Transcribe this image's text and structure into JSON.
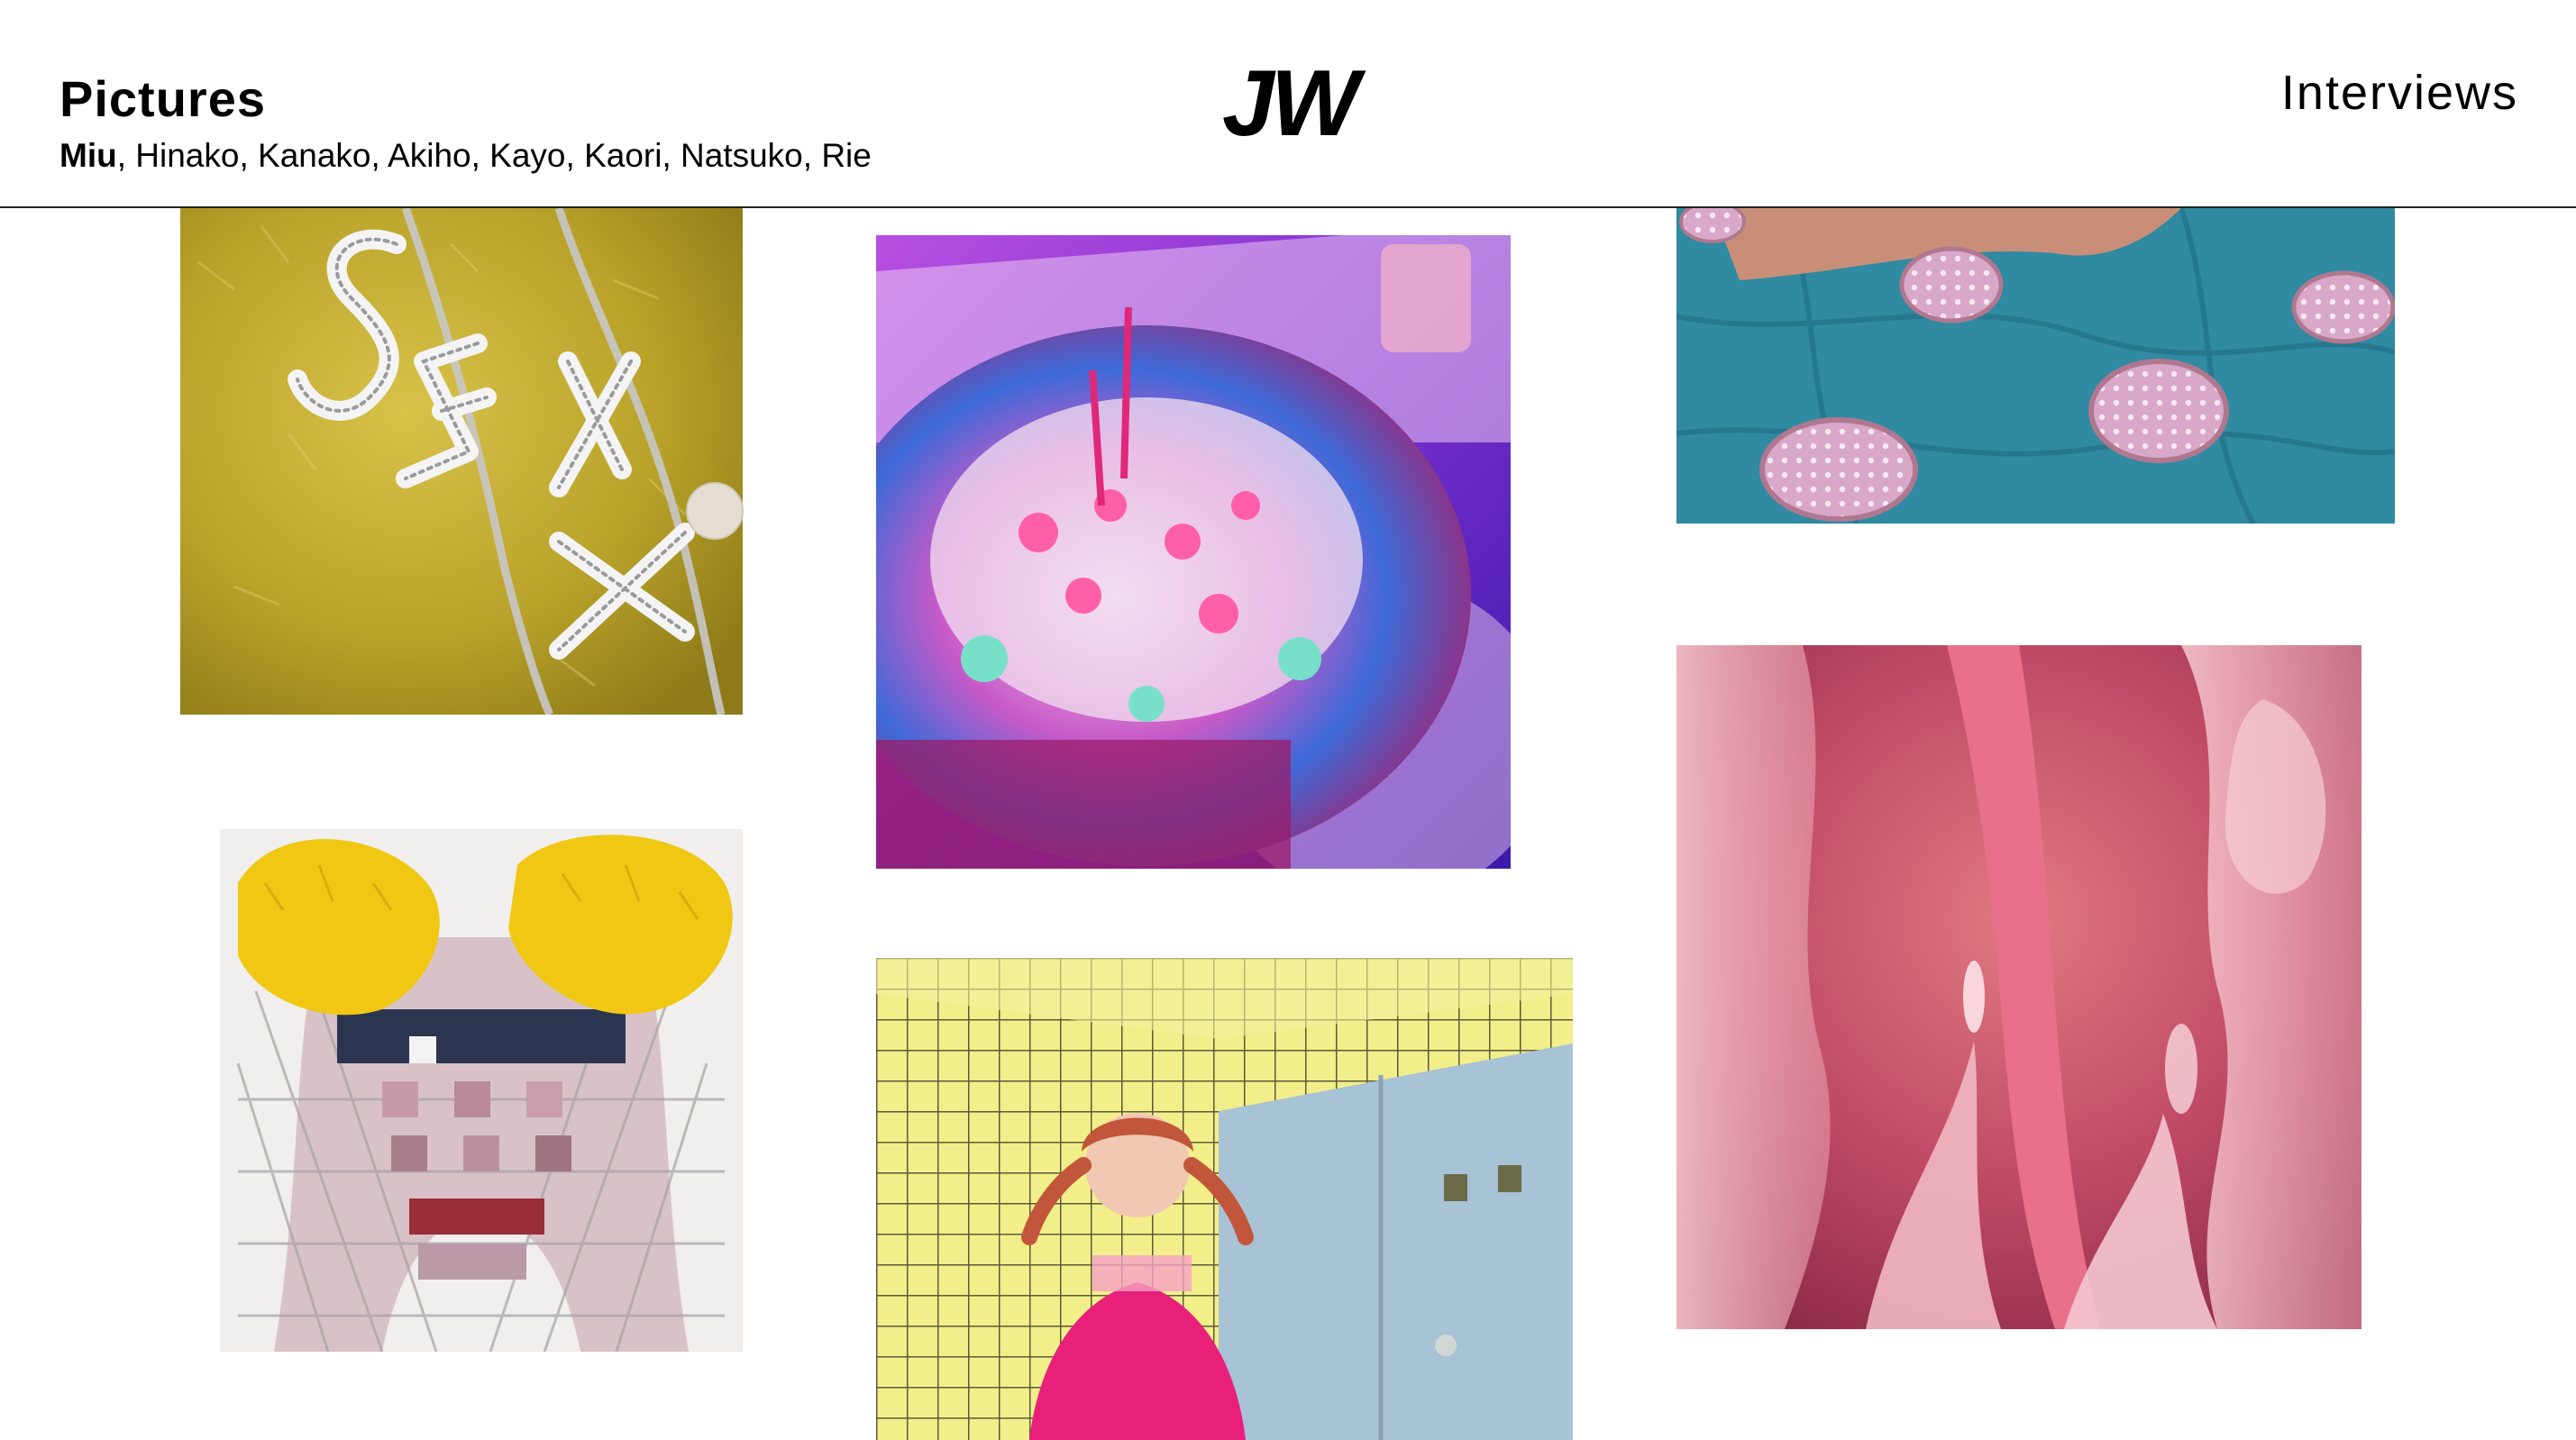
{
  "header": {
    "section_title": "Pictures",
    "logo": "JW",
    "nav_link": "Interviews",
    "names": [
      {
        "label": "Miu",
        "separator": ", "
      },
      {
        "label": "Hinako",
        "separator": ", "
      },
      {
        "label": "Kanako",
        "separator": ", "
      },
      {
        "label": "Akiho",
        "separator": ", "
      },
      {
        "label": "Kayo",
        "separator": ", "
      },
      {
        "label": "Kaori",
        "separator": ", "
      },
      {
        "label": "Natsuko",
        "separator": ", "
      },
      {
        "label": "Rie",
        "separator": ""
      }
    ],
    "active_name": "Miu"
  },
  "gallery": {
    "photos": [
      {
        "name": "photo-sexy-necklace",
        "alt_icon": "rhinestone-necklace-on-yellow-fur"
      },
      {
        "name": "photo-birthday-cake",
        "alt_icon": "candy-cake-with-candles"
      },
      {
        "name": "photo-polka-plates",
        "alt_icon": "pink-polka-dot-plates-on-blue-sheet"
      },
      {
        "name": "photo-mosaic-bodysuit",
        "alt_icon": "pixelated-bodysuit-with-yellow-fur"
      },
      {
        "name": "photo-girl-pigtails",
        "alt_icon": "girl-with-pigtails-in-yellow-tile-room"
      },
      {
        "name": "photo-pink-sculpture",
        "alt_icon": "pink-translucent-sculpture"
      }
    ]
  },
  "colors": {
    "text": "#000000",
    "background": "#ffffff",
    "divider": "#222222"
  }
}
